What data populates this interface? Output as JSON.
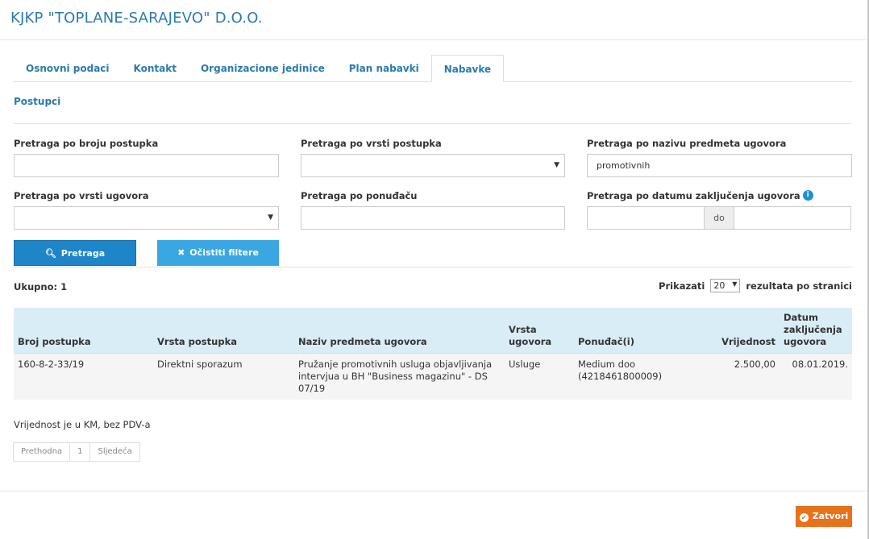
{
  "header": {
    "title": "KJKP \"TOPLANE-SARAJEVO\" D.O.O."
  },
  "tabs": [
    {
      "label": "Osnovni podaci"
    },
    {
      "label": "Kontakt"
    },
    {
      "label": "Organizacione jedinice"
    },
    {
      "label": "Plan nabavki"
    },
    {
      "label": "Nabavke"
    }
  ],
  "section": {
    "title": "Postupci"
  },
  "filters": {
    "broj_postupka": {
      "label": "Pretraga po broju postupka",
      "value": ""
    },
    "vrsta_postupka": {
      "label": "Pretraga po vrsti postupka",
      "value": ""
    },
    "naziv_predmeta": {
      "label": "Pretraga po nazivu predmeta ugovora",
      "value": "promotivnih"
    },
    "vrsta_ugovora": {
      "label": "Pretraga po vrsti ugovora",
      "value": ""
    },
    "ponudjac": {
      "label": "Pretraga po ponuđaču",
      "value": ""
    },
    "datum": {
      "label": "Pretraga po datumu zaključenja ugovora",
      "from": "",
      "separator": "do",
      "to": ""
    }
  },
  "buttons": {
    "search": "Pretraga",
    "clear": "Očistiti filtere",
    "close": "Zatvori"
  },
  "summary": {
    "total": "Ukupno: 1",
    "show_label": "Prikazati",
    "per_page": "20",
    "per_page_suffix": "rezultata po stranici"
  },
  "table": {
    "headers": [
      "Broj postupka",
      "Vrsta postupka",
      "Naziv predmeta ugovora",
      "Vrsta ugovora",
      "Ponuđač(i)",
      "Vrijednost",
      "Datum zaključenja ugovora"
    ],
    "rows": [
      [
        "160-8-2-33/19",
        "Direktni sporazum",
        "Pružanje promotivnih usluga objavljivanja intervjua u BH \"Business magazinu\" - DS 07/19",
        "Usluge",
        "Medium doo (4218461800009)",
        "2.500,00",
        "08.01.2019."
      ]
    ]
  },
  "note": "Vrijednost je u KM, bez PDV-a",
  "pager": {
    "prev": "Prethodna",
    "page": "1",
    "next": "Sljedeća"
  },
  "colors": {
    "link_blue": "#2a7ab0",
    "primary": "#1f85c9",
    "info": "#3aa7e2",
    "close": "#e8721b",
    "table_header": "#d9edf7"
  }
}
